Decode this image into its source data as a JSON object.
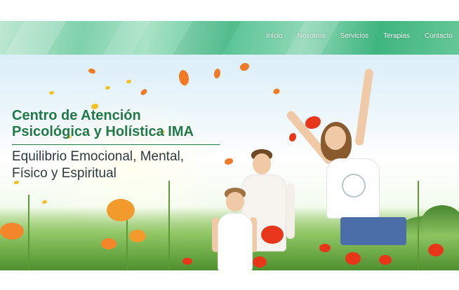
{
  "nav": {
    "items": [
      {
        "label": "Inicio"
      },
      {
        "label": "Nosotros"
      },
      {
        "label": "Servicios"
      },
      {
        "label": "Terapias"
      },
      {
        "label": "Contacto"
      }
    ],
    "colors": {
      "accent": "#3fb57f",
      "text": "#ffffff"
    }
  },
  "hero": {
    "title_line1": "Centro de Atención",
    "title_line2": "Psicológica y Holística IMA",
    "subtitle_line1": "Equilibrio Emocional, Mental,",
    "subtitle_line2": "Físico y Espiritual",
    "colors": {
      "title": "#1f7a47",
      "subtitle": "#2c3a3a",
      "poppy": "#e8361b",
      "petal": "#f07a25"
    }
  }
}
